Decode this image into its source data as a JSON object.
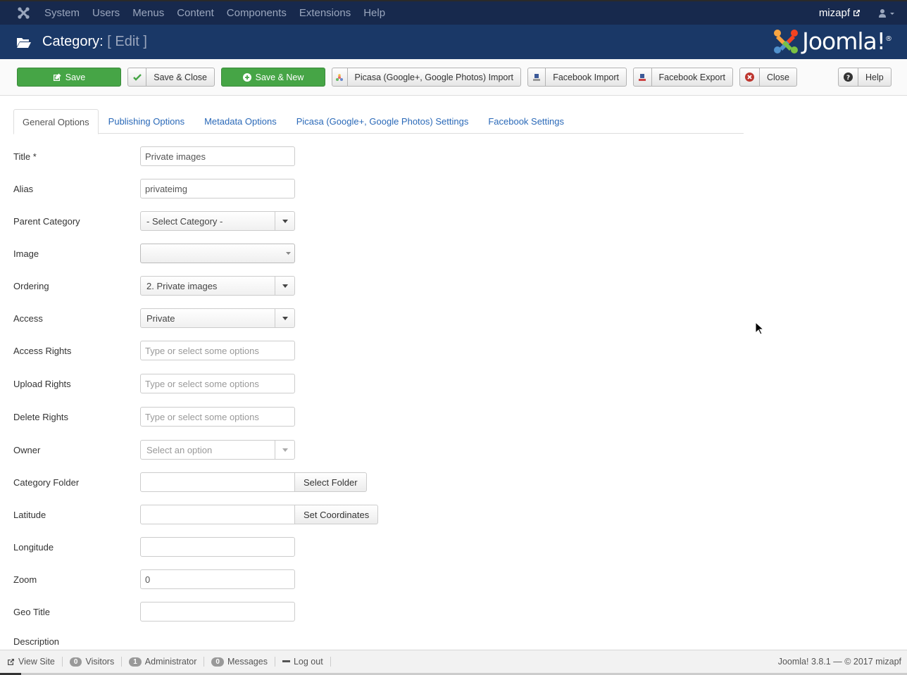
{
  "topnav": {
    "menu": [
      "System",
      "Users",
      "Menus",
      "Content",
      "Components",
      "Extensions",
      "Help"
    ],
    "username": "mizapf"
  },
  "header": {
    "title_main": "Category:",
    "title_sub": "[ Edit ]",
    "brand": "Joomla!",
    "brand_mark": "®"
  },
  "toolbar": {
    "save": "Save",
    "save_close": "Save & Close",
    "save_new": "Save & New",
    "picasa_import": "Picasa (Google+, Google Photos) Import",
    "facebook_import": "Facebook Import",
    "facebook_export": "Facebook Export",
    "close": "Close",
    "help": "Help"
  },
  "tabs": [
    "General Options",
    "Publishing Options",
    "Metadata Options",
    "Picasa (Google+, Google Photos) Settings",
    "Facebook Settings"
  ],
  "form": {
    "title_label": "Title *",
    "title_value": "Private images",
    "alias_label": "Alias",
    "alias_value": "privateimg",
    "parent_label": "Parent Category",
    "parent_value": "- Select Category -",
    "image_label": "Image",
    "ordering_label": "Ordering",
    "ordering_value": "2. Private images",
    "access_label": "Access",
    "access_value": "Private",
    "access_rights_label": "Access Rights",
    "upload_rights_label": "Upload Rights",
    "delete_rights_label": "Delete Rights",
    "rights_placeholder": "Type or select some options",
    "owner_label": "Owner",
    "owner_placeholder": "Select an option",
    "folder_label": "Category Folder",
    "folder_button": "Select Folder",
    "latitude_label": "Latitude",
    "coords_button": "Set Coordinates",
    "longitude_label": "Longitude",
    "zoom_label": "Zoom",
    "zoom_value": "0",
    "geotitle_label": "Geo Title",
    "description_label": "Description"
  },
  "footer": {
    "view_site": "View Site",
    "visitors_count": "0",
    "visitors": "Visitors",
    "admin_count": "1",
    "admin": "Administrator",
    "messages_count": "0",
    "messages": "Messages",
    "logout": "Log out",
    "version": "Joomla! 3.8.1  —  © 2017 mizapf"
  },
  "colors": {
    "topnav_bg": "#17294d",
    "header_bg": "#1a3867",
    "save_green": "#46a546",
    "link_blue": "#2a69b8",
    "close_red": "#bd362f"
  }
}
